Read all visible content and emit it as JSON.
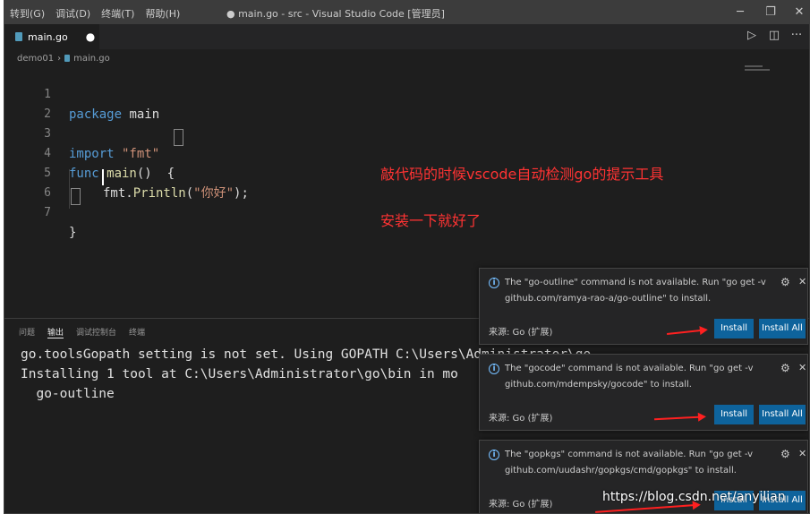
{
  "titlebar": {
    "menu": [
      "转到(G)",
      "调试(D)",
      "终端(T)",
      "帮助(H)"
    ],
    "title": "● main.go - src - Visual Studio Code [管理员]",
    "minimize": "─",
    "maximize": "❐",
    "close": "✕"
  },
  "tab": {
    "label": "main.go",
    "dirty": "●",
    "run": "▷",
    "split": "◫",
    "more": "···"
  },
  "breadcrumb": {
    "folder": "demo01",
    "separator": "›",
    "file": "main.go"
  },
  "editor": {
    "lines": [
      "1",
      "2",
      "3",
      "4",
      "5",
      "6",
      "7"
    ],
    "code": {
      "l1_kw": "package",
      "l1_id": " main",
      "l3_kw": "import",
      "l3_str": " \"fmt\"",
      "l4_kw": "func",
      "l4_fn": " main",
      "l4_rest": "()  {",
      "l5_pre": "fmt.",
      "l5_fn": "Println",
      "l5_open": "(",
      "l5_str": "\"你好\"",
      "l5_close": ");",
      "l7": "}"
    }
  },
  "annotations": {
    "line1": "敲代码的时候vscode自动检测go的提示工具",
    "line2": "安装一下就好了"
  },
  "panel": {
    "tabs": [
      "问题",
      "输出",
      "调试控制台",
      "终端"
    ],
    "output": [
      "go.toolsGopath setting is not set. Using GOPATH C:\\Users\\Administrator\\go",
      "Installing 1 tool at C:\\Users\\Administrator\\go\\bin in mo",
      "  go-outline"
    ]
  },
  "notifications": [
    {
      "msg1": "The \"go-outline\" command is not available. Run \"go get -v",
      "msg2": "github.com/ramya-rao-a/go-outline\" to install.",
      "source": "来源: Go (扩展)",
      "install": "Install",
      "install_all": "Install All"
    },
    {
      "msg1": "The \"gocode\" command is not available. Run \"go get -v",
      "msg2": "github.com/mdempsky/gocode\" to install.",
      "source": "来源: Go (扩展)",
      "install": "Install",
      "install_all": "Install All"
    },
    {
      "msg1": "The \"gopkgs\" command is not available. Run \"go get -v",
      "msg2": "github.com/uudashr/gopkgs/cmd/gopkgs\" to install.",
      "source": "来源: Go (扩展)",
      "install": "Install",
      "install_all": "Install All"
    }
  ],
  "watermark": "https://blog.csdn.net/anyilian",
  "colors": {
    "accent_button": "#0e639c",
    "annotation": "#ff3333",
    "keyword": "#569cd6",
    "string": "#ce9178"
  }
}
